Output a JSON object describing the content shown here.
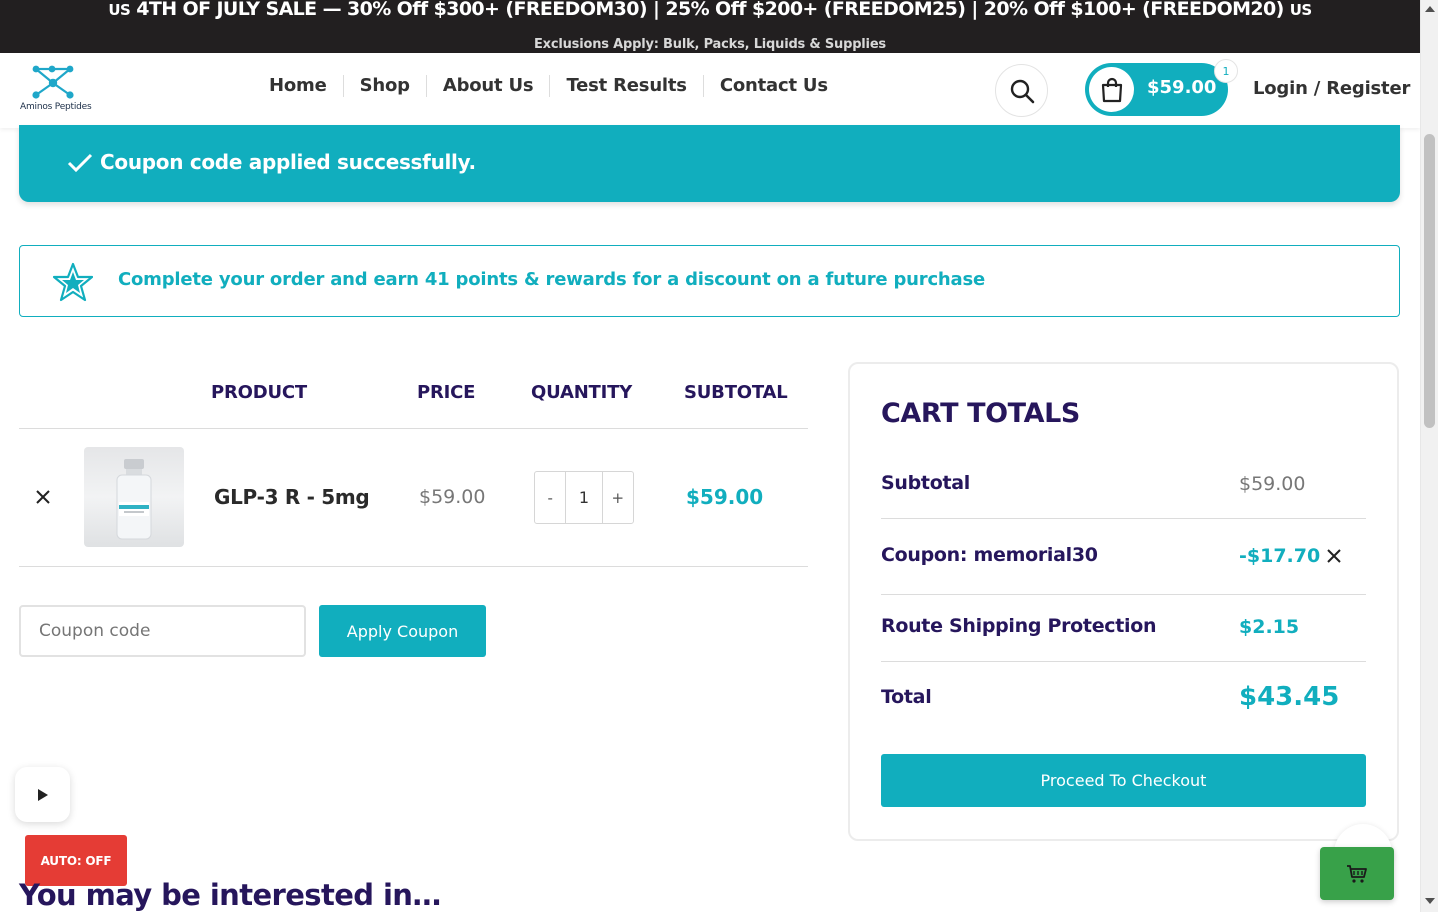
{
  "announcement": {
    "flag_left": "US",
    "sale_text": "4TH OF JULY SALE — 30% Off $300+ (FREEDOM30) | 25% Off $200+ (FREEDOM25) | 20% Off $100+ (FREEDOM20)",
    "flag_right": "US",
    "exclusions": "Exclusions Apply: Bulk, Packs, Liquids & Supplies"
  },
  "header": {
    "logo_text": "Aminos Peptides",
    "nav": [
      "Home",
      "Shop",
      "About Us",
      "Test Results",
      "Contact Us"
    ],
    "cart_amount": "$59.00",
    "cart_count": "1",
    "login_label": "Login / Register"
  },
  "notice": {
    "message": "Coupon code applied successfully."
  },
  "rewards": {
    "message": "Complete your order and earn 41 points & rewards for a discount on a future purchase"
  },
  "cart": {
    "headers": {
      "product": "PRODUCT",
      "price": "PRICE",
      "quantity": "QUANTITY",
      "subtotal": "SUBTOTAL"
    },
    "items": [
      {
        "name": "GLP-3 R - 5mg",
        "price": "$59.00",
        "quantity": "1",
        "subtotal": "$59.00",
        "minus": "-",
        "plus": "+"
      }
    ],
    "coupon_placeholder": "Coupon code",
    "apply_coupon_label": "Apply Coupon"
  },
  "totals": {
    "title": "CART TOTALS",
    "subtotal_label": "Subtotal",
    "subtotal_value": "$59.00",
    "coupon_label": "Coupon: memorial30",
    "coupon_value": "-$17.70",
    "route_label": "Route Shipping Protection",
    "route_value": "$2.15",
    "total_label": "Total",
    "total_value": "$43.45",
    "checkout_label": "Proceed To Checkout"
  },
  "widgets": {
    "auto_label": "AUTO: OFF"
  },
  "section": {
    "interested_title": "You may be interested in…"
  },
  "colors": {
    "accent": "#11aebe",
    "heading": "#26165c",
    "announce_bg": "#221f20",
    "auto_off_bg": "#e53c35",
    "float_cart_bg": "#38a149"
  },
  "icons": [
    "logo-molecule-icon",
    "search-icon",
    "shopping-bag-icon",
    "check-icon",
    "star-icon",
    "close-icon",
    "play-icon",
    "cart-icon"
  ]
}
